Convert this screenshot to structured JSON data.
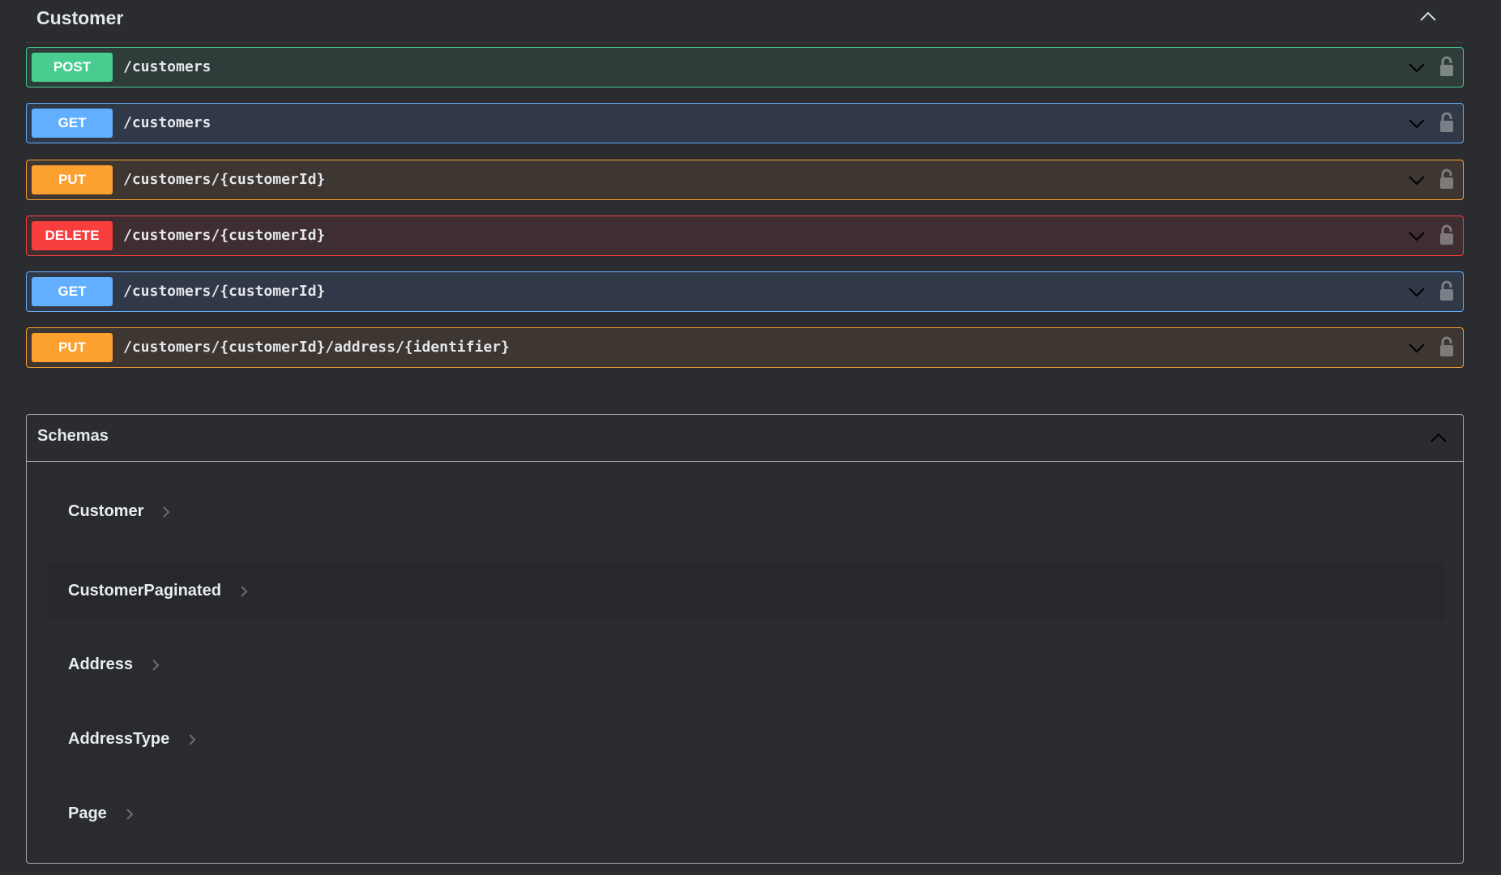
{
  "tag": {
    "title": "Customer",
    "expanded": true
  },
  "operations": [
    {
      "method": "POST",
      "path": "/customers"
    },
    {
      "method": "GET",
      "path": "/customers"
    },
    {
      "method": "PUT",
      "path": "/customers/{customerId}"
    },
    {
      "method": "DELETE",
      "path": "/customers/{customerId}"
    },
    {
      "method": "GET",
      "path": "/customers/{customerId}"
    },
    {
      "method": "PUT",
      "path": "/customers/{customerId}/address/{identifier}"
    }
  ],
  "schemas": {
    "title": "Schemas",
    "expanded": true,
    "items": [
      {
        "name": "Customer"
      },
      {
        "name": "CustomerPaginated"
      },
      {
        "name": "Address"
      },
      {
        "name": "AddressType"
      },
      {
        "name": "Page"
      }
    ]
  },
  "colors": {
    "post": "#49cc90",
    "get": "#61affe",
    "put": "#fca130",
    "delete": "#f93e3e",
    "background": "#2b2c30"
  },
  "icons": {
    "tag_toggle": "chevron-up-icon",
    "operation_toggle": "chevron-down-icon",
    "operation_auth": "unlocked-padlock-icon",
    "schema_expand": "chevron-right-icon"
  }
}
